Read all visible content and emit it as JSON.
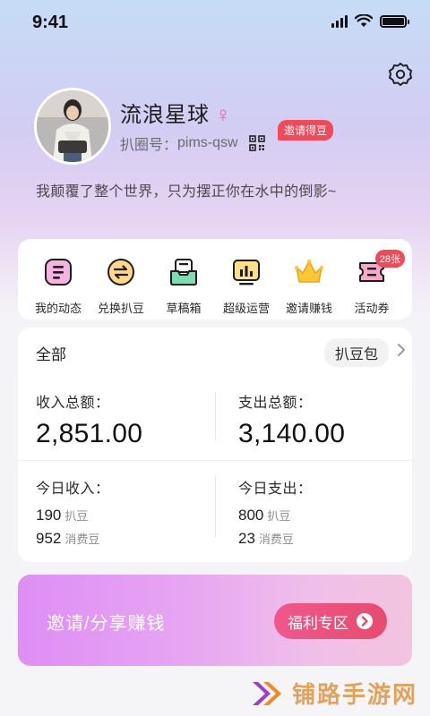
{
  "status": {
    "time": "9:41"
  },
  "profile": {
    "nickname": "流浪星球",
    "gender_symbol": "♀",
    "id_label": "扒圈号：",
    "id_value": "pims-qsw",
    "invite_badge": "邀请得豆",
    "bio": "我颠覆了整个世界，只为摆正你在水中的倒影~"
  },
  "shortcuts": [
    {
      "label": "我的动态",
      "icon": "dynamic-icon"
    },
    {
      "label": "兑换扒豆",
      "icon": "exchange-icon"
    },
    {
      "label": "草稿箱",
      "icon": "drafts-icon"
    },
    {
      "label": "超级运营",
      "icon": "operations-icon"
    },
    {
      "label": "邀请赚钱",
      "icon": "crown-icon"
    },
    {
      "label": "活动券",
      "icon": "coupon-icon",
      "badge": "28张"
    }
  ],
  "wallet": {
    "title": "全部",
    "pill": "扒豆包",
    "income_total_label": "收入总额：",
    "income_total": "2,851.00",
    "expense_total_label": "支出总额：",
    "expense_total": "3,140.00",
    "today_income_label": "今日收入：",
    "today_expense_label": "今日支出：",
    "today_income": [
      {
        "value": "190",
        "unit": "扒豆"
      },
      {
        "value": "952",
        "unit": "消费豆"
      }
    ],
    "today_expense": [
      {
        "value": "800",
        "unit": "扒豆"
      },
      {
        "value": "23",
        "unit": "消费豆"
      }
    ]
  },
  "banner": {
    "text": "邀请/分享赚钱",
    "button": "福利专区"
  },
  "watermark": {
    "text": "铺路手游网"
  },
  "colors": {
    "accent_red": "#ef4a5a",
    "gender_pink": "#f05d9c",
    "banner_button": "#e84b6e",
    "watermark_gold": "#e0a25d"
  }
}
